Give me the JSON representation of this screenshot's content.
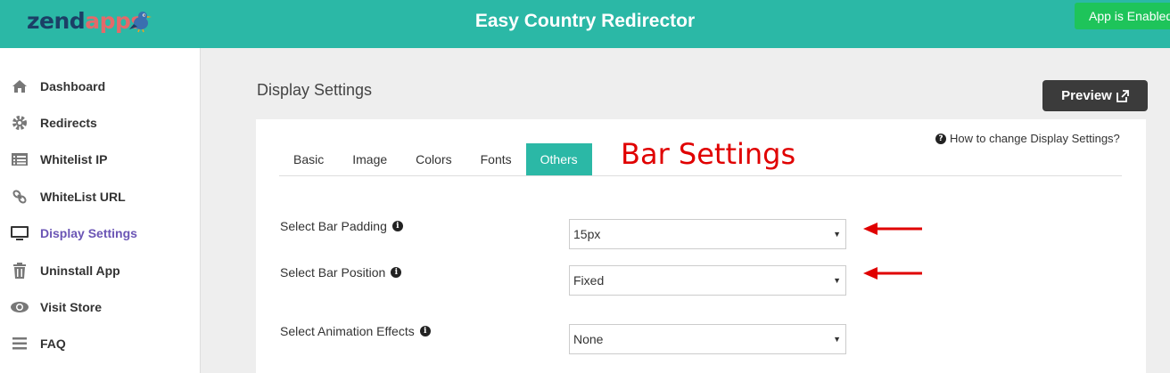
{
  "header": {
    "logo_part1": "zend",
    "logo_part2": "apps",
    "title": "Easy Country Redirector",
    "status_button": "App is Enabled"
  },
  "sidebar": {
    "items": [
      {
        "label": "Dashboard",
        "icon": "home-icon"
      },
      {
        "label": "Redirects",
        "icon": "gear-icon"
      },
      {
        "label": "Whitelist IP",
        "icon": "list-icon"
      },
      {
        "label": "WhiteList URL",
        "icon": "link-icon"
      },
      {
        "label": "Display Settings",
        "icon": "monitor-icon",
        "active": true
      },
      {
        "label": "Uninstall App",
        "icon": "trash-icon"
      },
      {
        "label": "Visit Store",
        "icon": "eye-icon"
      },
      {
        "label": "FAQ",
        "icon": "bars-icon"
      }
    ]
  },
  "main": {
    "title": "Display Settings",
    "preview_label": "Preview",
    "help_text": "How to change Display Settings?",
    "tabs": [
      {
        "label": "Basic"
      },
      {
        "label": "Image"
      },
      {
        "label": "Colors"
      },
      {
        "label": "Fonts"
      },
      {
        "label": "Others",
        "active": true
      }
    ],
    "annotation": "Bar Settings",
    "fields": [
      {
        "label": "Select Bar Padding",
        "value": "15px"
      },
      {
        "label": "Select Bar Position",
        "value": "Fixed"
      },
      {
        "label": "Select Animation Effects",
        "value": "None"
      }
    ]
  },
  "colors": {
    "header_teal": "#2bb8a6",
    "enabled_green": "#1ec45a",
    "active_nav": "#6b55b5",
    "annotation_red": "#e00000"
  }
}
